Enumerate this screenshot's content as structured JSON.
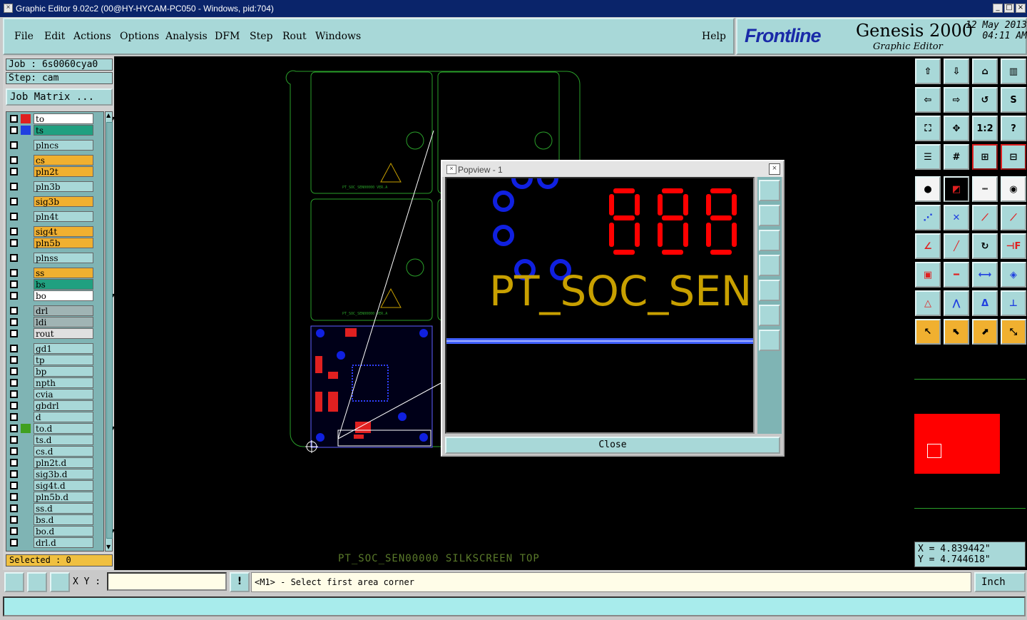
{
  "window": {
    "title": "Graphic Editor 9.02c2 (00@HY-HYCAM-PC050 - Windows, pid:704)"
  },
  "menu": {
    "file": "File",
    "edit": "Edit",
    "actions": "Actions",
    "options": "Options",
    "analysis": "Analysis",
    "dfm": "DFM",
    "step": "Step",
    "rout": "Rout",
    "windows": "Windows",
    "help": "Help"
  },
  "brand": {
    "logo": "Frontline",
    "product": "Genesis 2000",
    "subtitle": "Graphic Editor",
    "date": "12 May 2013",
    "time": "04:11 AM"
  },
  "job": {
    "job_line": "Job : 6s0060cya0",
    "step_line": "Step: cam",
    "matrix_button": "Job Matrix ..."
  },
  "layers": [
    {
      "name": "to",
      "bg": "#ffffff",
      "color": "#e02020",
      "marker": "board-icon"
    },
    {
      "name": "ts",
      "bg": "#20a080",
      "color": "#2040e0",
      "marker": ""
    },
    {
      "name": "plncs",
      "bg": "#a8d8d8",
      "color": "",
      "marker": ""
    },
    {
      "name": "cs",
      "bg": "#f0b030",
      "color": "",
      "marker": ""
    },
    {
      "name": "pln2t",
      "bg": "#f0b030",
      "color": "",
      "marker": ""
    },
    {
      "name": "pln3b",
      "bg": "#a8d8d8",
      "color": "",
      "marker": ""
    },
    {
      "name": "sig3b",
      "bg": "#f0b030",
      "color": "",
      "marker": ""
    },
    {
      "name": "pln4t",
      "bg": "#a8d8d8",
      "color": "",
      "marker": ""
    },
    {
      "name": "sig4t",
      "bg": "#f0b030",
      "color": "",
      "marker": ""
    },
    {
      "name": "pln5b",
      "bg": "#f0b030",
      "color": "",
      "marker": ""
    },
    {
      "name": "plnss",
      "bg": "#a8d8d8",
      "color": "",
      "marker": ""
    },
    {
      "name": "ss",
      "bg": "#f0b030",
      "color": "",
      "marker": ""
    },
    {
      "name": "bs",
      "bg": "#20a080",
      "color": "",
      "marker": ""
    },
    {
      "name": "bo",
      "bg": "#ffffff",
      "color": "",
      "marker": "board-icon"
    },
    {
      "name": "drl",
      "bg": "#a0b4b4",
      "color": "",
      "marker": ""
    },
    {
      "name": "ldi",
      "bg": "#a0b4b4",
      "color": "",
      "marker": ""
    },
    {
      "name": "rout",
      "bg": "#e0e0e0",
      "color": "",
      "marker": ""
    },
    {
      "name": "gd1",
      "bg": "#a8d8d8",
      "color": "",
      "marker": ""
    },
    {
      "name": "tp",
      "bg": "#a8d8d8",
      "color": "",
      "marker": ""
    },
    {
      "name": "bp",
      "bg": "#a8d8d8",
      "color": "",
      "marker": ""
    },
    {
      "name": "npth",
      "bg": "#a8d8d8",
      "color": "",
      "marker": ""
    },
    {
      "name": "cvia",
      "bg": "#a8d8d8",
      "color": "",
      "marker": ""
    },
    {
      "name": "gbdrl",
      "bg": "#a8d8d8",
      "color": "",
      "marker": ""
    },
    {
      "name": "d",
      "bg": "#a8d8d8",
      "color": "",
      "marker": ""
    },
    {
      "name": "to.d",
      "bg": "#a8d8d8",
      "color": "#40a020",
      "marker": "board-icon"
    },
    {
      "name": "ts.d",
      "bg": "#a8d8d8",
      "color": "",
      "marker": ""
    },
    {
      "name": "cs.d",
      "bg": "#a8d8d8",
      "color": "",
      "marker": ""
    },
    {
      "name": "pln2t.d",
      "bg": "#a8d8d8",
      "color": "",
      "marker": ""
    },
    {
      "name": "sig3b.d",
      "bg": "#a8d8d8",
      "color": "",
      "marker": ""
    },
    {
      "name": "sig4t.d",
      "bg": "#a8d8d8",
      "color": "",
      "marker": ""
    },
    {
      "name": "pln5b.d",
      "bg": "#a8d8d8",
      "color": "",
      "marker": ""
    },
    {
      "name": "ss.d",
      "bg": "#a8d8d8",
      "color": "",
      "marker": ""
    },
    {
      "name": "bs.d",
      "bg": "#a8d8d8",
      "color": "",
      "marker": ""
    },
    {
      "name": "bo.d",
      "bg": "#a8d8d8",
      "color": "",
      "marker": "board-icon"
    },
    {
      "name": "drl.d",
      "bg": "#a8d8d8",
      "color": "",
      "marker": ""
    }
  ],
  "selected": "Selected : 0",
  "canvas": {
    "status_label": "PT_SOC_SEN00000 SILKSCREEN TOP",
    "silk_text": "PT_SOC_SEN00000 VER.A"
  },
  "popview": {
    "title": "Popview - 1",
    "silk_text": "PT_SOC_SEN",
    "close_label": "Close"
  },
  "coords": {
    "x": "X = 4.839442\"",
    "y": "Y = 4.744618\""
  },
  "bottom": {
    "xy_label": "X Y :",
    "prompt": "<M1> - Select first area corner",
    "unit": "Inch"
  },
  "colors": {
    "panel": "#a8d8d8",
    "silk": "#c8a000",
    "pad": "#1020e0",
    "outline": "#2aa02a",
    "highlight": "#ff0000"
  }
}
